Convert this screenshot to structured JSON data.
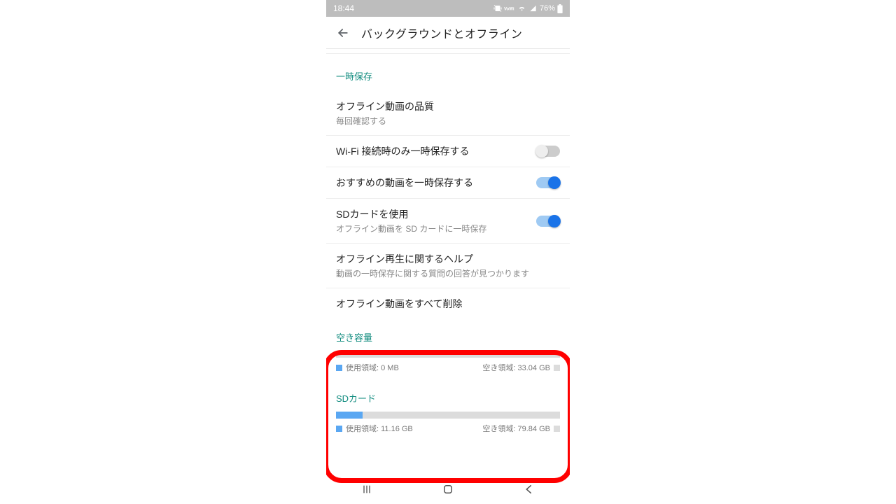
{
  "status": {
    "time": "18:44",
    "battery_text": "76%"
  },
  "appbar": {
    "title": "バックグラウンドとオフライン"
  },
  "section_temp_save": {
    "header": "一時保存"
  },
  "quality": {
    "title": "オフライン動画の品質",
    "sub": "毎回確認する"
  },
  "wifi_only": {
    "title": "Wi-Fi 接続時のみ一時保存する",
    "state": "off"
  },
  "recommend": {
    "title": "おすすめの動画を一時保存する",
    "state": "on"
  },
  "sdcard": {
    "title": "SDカードを使用",
    "sub": "オフライン動画を SD カードに一時保存",
    "state": "on"
  },
  "help": {
    "title": "オフライン再生に関するヘルプ",
    "sub": "動画の一時保存に関する質問の回答が見つかります"
  },
  "delete_all": {
    "title": "オフライン動画をすべて削除"
  },
  "storage_internal": {
    "title": "空き容量",
    "used_label": "使用領域: 0 MB",
    "free_label": "空き領域: 33.04 GB",
    "used_pct": 0
  },
  "storage_sd": {
    "title": "SDカード",
    "used_label": "使用領域: 11.16 GB",
    "free_label": "空き領域: 79.84 GB",
    "used_pct": 12
  }
}
